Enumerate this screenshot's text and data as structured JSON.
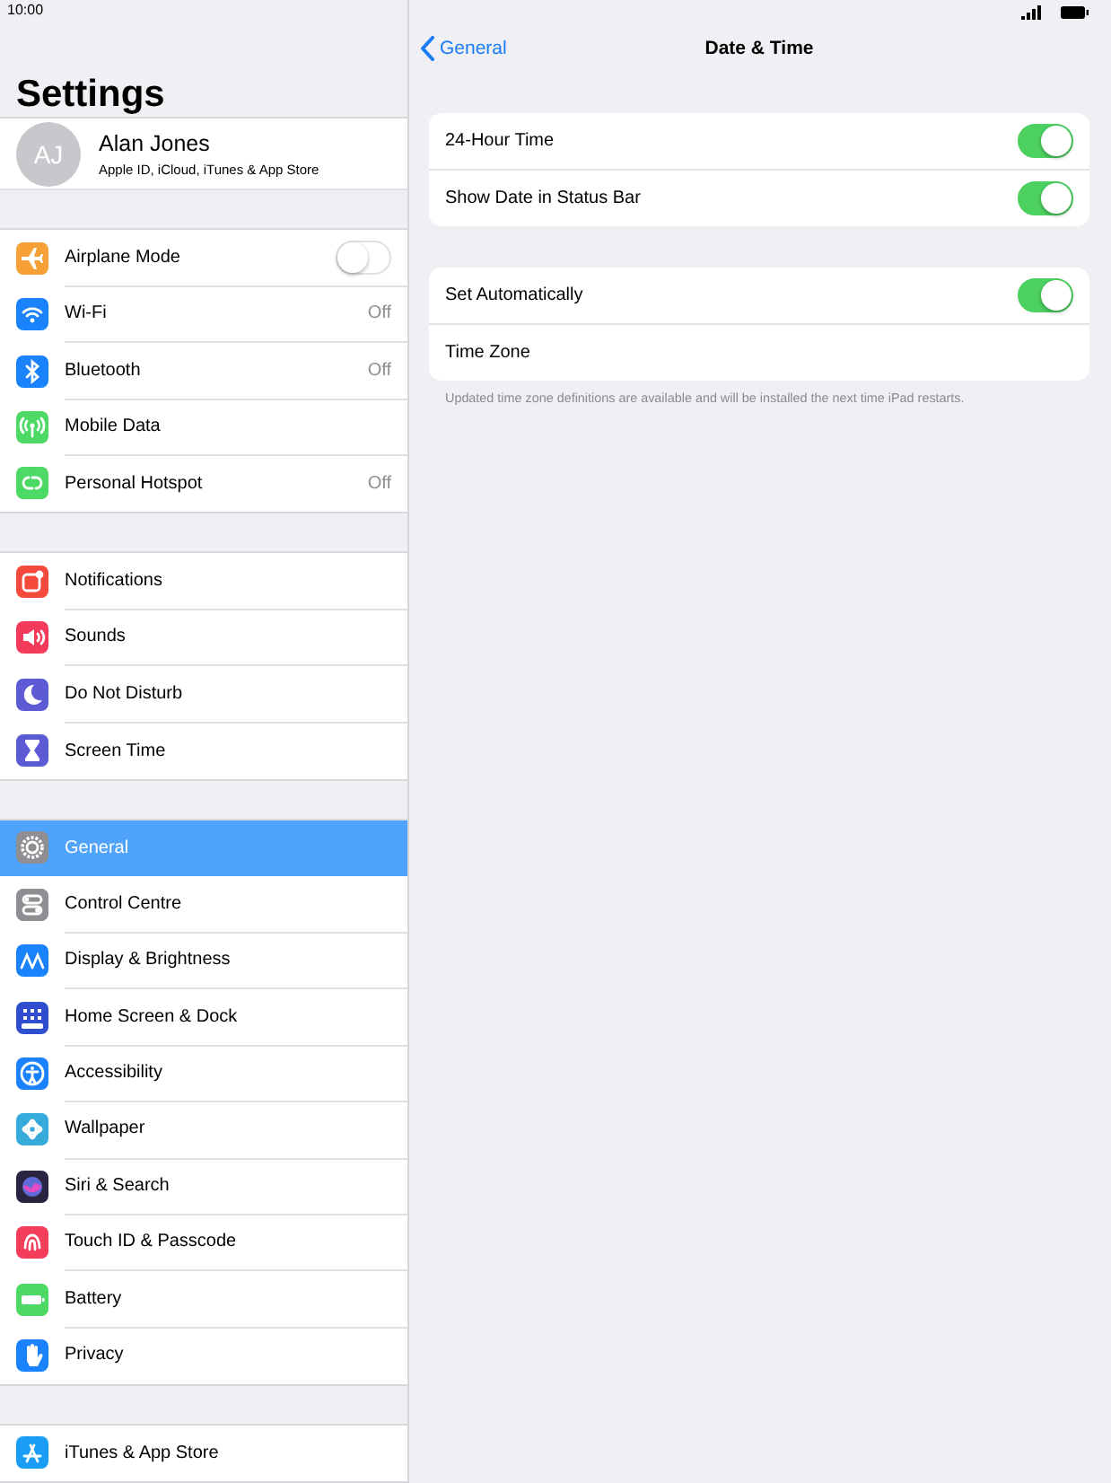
{
  "status_bar": {
    "time": "10:00"
  },
  "sidebar": {
    "title": "Settings",
    "profile": {
      "initials": "AJ",
      "name": "Alan Jones",
      "subtitle": "Apple ID, iCloud, iTunes & App Store"
    },
    "groups": [
      {
        "items": [
          {
            "label": "Airplane Mode",
            "color": "#f7a035",
            "kind": "toggle",
            "on": false,
            "selected": false
          },
          {
            "label": "Wi-Fi",
            "color": "#1a82fb",
            "kind": "value",
            "value": "Off",
            "selected": false
          },
          {
            "label": "Bluetooth",
            "color": "#1a82fb",
            "kind": "value",
            "value": "Off",
            "selected": false
          },
          {
            "label": "Mobile Data",
            "color": "#4cd964",
            "kind": "link",
            "selected": false
          },
          {
            "label": "Personal Hotspot",
            "color": "#4cd964",
            "kind": "value",
            "value": "Off",
            "selected": false
          }
        ]
      },
      {
        "items": [
          {
            "label": "Notifications",
            "color": "#f34a3b",
            "kind": "link",
            "selected": false
          },
          {
            "label": "Sounds",
            "color": "#f43a5a",
            "kind": "link",
            "selected": false
          },
          {
            "label": "Do Not Disturb",
            "color": "#5d5ad6",
            "kind": "link",
            "selected": false
          },
          {
            "label": "Screen Time",
            "color": "#5d5ad6",
            "kind": "link",
            "selected": false
          }
        ]
      },
      {
        "items": [
          {
            "label": "General",
            "color": "#8e8e93",
            "kind": "link",
            "selected": true
          },
          {
            "label": "Control Centre",
            "color": "#8e8e93",
            "kind": "link",
            "selected": false
          },
          {
            "label": "Display & Brightness",
            "color": "#1a82fb",
            "kind": "link",
            "selected": false
          },
          {
            "label": "Home Screen & Dock",
            "color": "#2f4fd0",
            "kind": "link",
            "selected": false
          },
          {
            "label": "Accessibility",
            "color": "#1a82fb",
            "kind": "link",
            "selected": false
          },
          {
            "label": "Wallpaper",
            "color": "#37aadc",
            "kind": "link",
            "selected": false
          },
          {
            "label": "Siri & Search",
            "color": "#2a2440",
            "kind": "link",
            "selected": false
          },
          {
            "label": "Touch ID & Passcode",
            "color": "#f33d5b",
            "kind": "link",
            "selected": false
          },
          {
            "label": "Battery",
            "color": "#4cd964",
            "kind": "link",
            "selected": false
          },
          {
            "label": "Privacy",
            "color": "#1a82fb",
            "kind": "link",
            "selected": false
          }
        ]
      },
      {
        "items": [
          {
            "label": "iTunes & App Store",
            "color": "#1a9ef5",
            "kind": "link",
            "selected": false
          }
        ]
      }
    ]
  },
  "detail": {
    "back": "General",
    "title": "Date & Time",
    "groups": [
      {
        "rows": [
          {
            "label": "24-Hour Time",
            "kind": "toggle",
            "on": true
          },
          {
            "label": "Show Date in Status Bar",
            "kind": "toggle",
            "on": true
          }
        ]
      },
      {
        "rows": [
          {
            "label": "Set Automatically",
            "kind": "toggle",
            "on": true
          },
          {
            "label": "Time Zone",
            "kind": "link"
          }
        ],
        "footnote": "Updated time zone definitions are available and will be installed the next time iPad restarts."
      }
    ]
  }
}
